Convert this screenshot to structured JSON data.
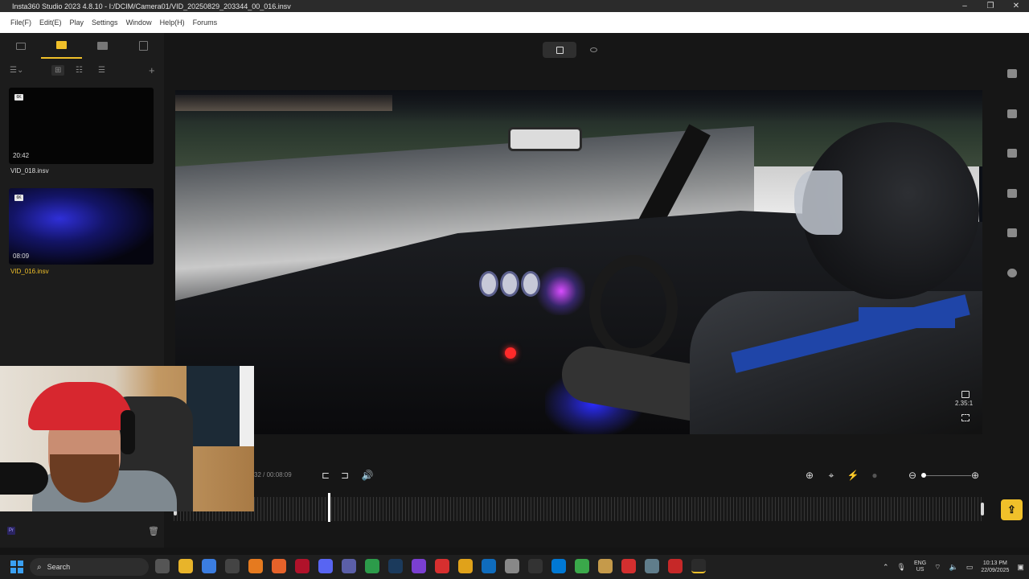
{
  "window": {
    "title": "Insta360 Studio 2023 4.8.10 - I:/DCIM/Camera01/VID_20250829_203344_00_016.insv",
    "controls": [
      "–",
      "❐",
      "✕"
    ]
  },
  "menu": [
    "File(F)",
    "Edit(E)",
    "Play",
    "Settings",
    "Window",
    "Help(H)",
    "Forums"
  ],
  "library": {
    "tabs": [
      "monitor-icon",
      "folder-icon",
      "media-icon",
      "document-icon"
    ],
    "active_tab": 1,
    "tools": [
      "☰⌄",
      "⊞",
      "☷",
      "☰",
      "+"
    ],
    "files": [
      {
        "badge": "6K",
        "duration": "20:42",
        "name": "VID_018.insv",
        "selected": false
      },
      {
        "badge": "6K",
        "duration": "08:09",
        "name": "VID_016.insv",
        "selected": true
      }
    ]
  },
  "preview": {
    "aspect_ratio": "2.35:1"
  },
  "playback": {
    "timecode": "32 / 00:08:09",
    "volume_icon": "speaker-icon"
  },
  "timeline": {
    "playhead_fraction": 0.19
  },
  "colors": {
    "accent": "#f0c02a",
    "background": "#161616",
    "panel": "#1c1c1c"
  },
  "taskbar": {
    "search_placeholder": "Search",
    "language": [
      "ENG",
      "US"
    ],
    "time": "10:13 PM",
    "date": "22/09/2025"
  }
}
